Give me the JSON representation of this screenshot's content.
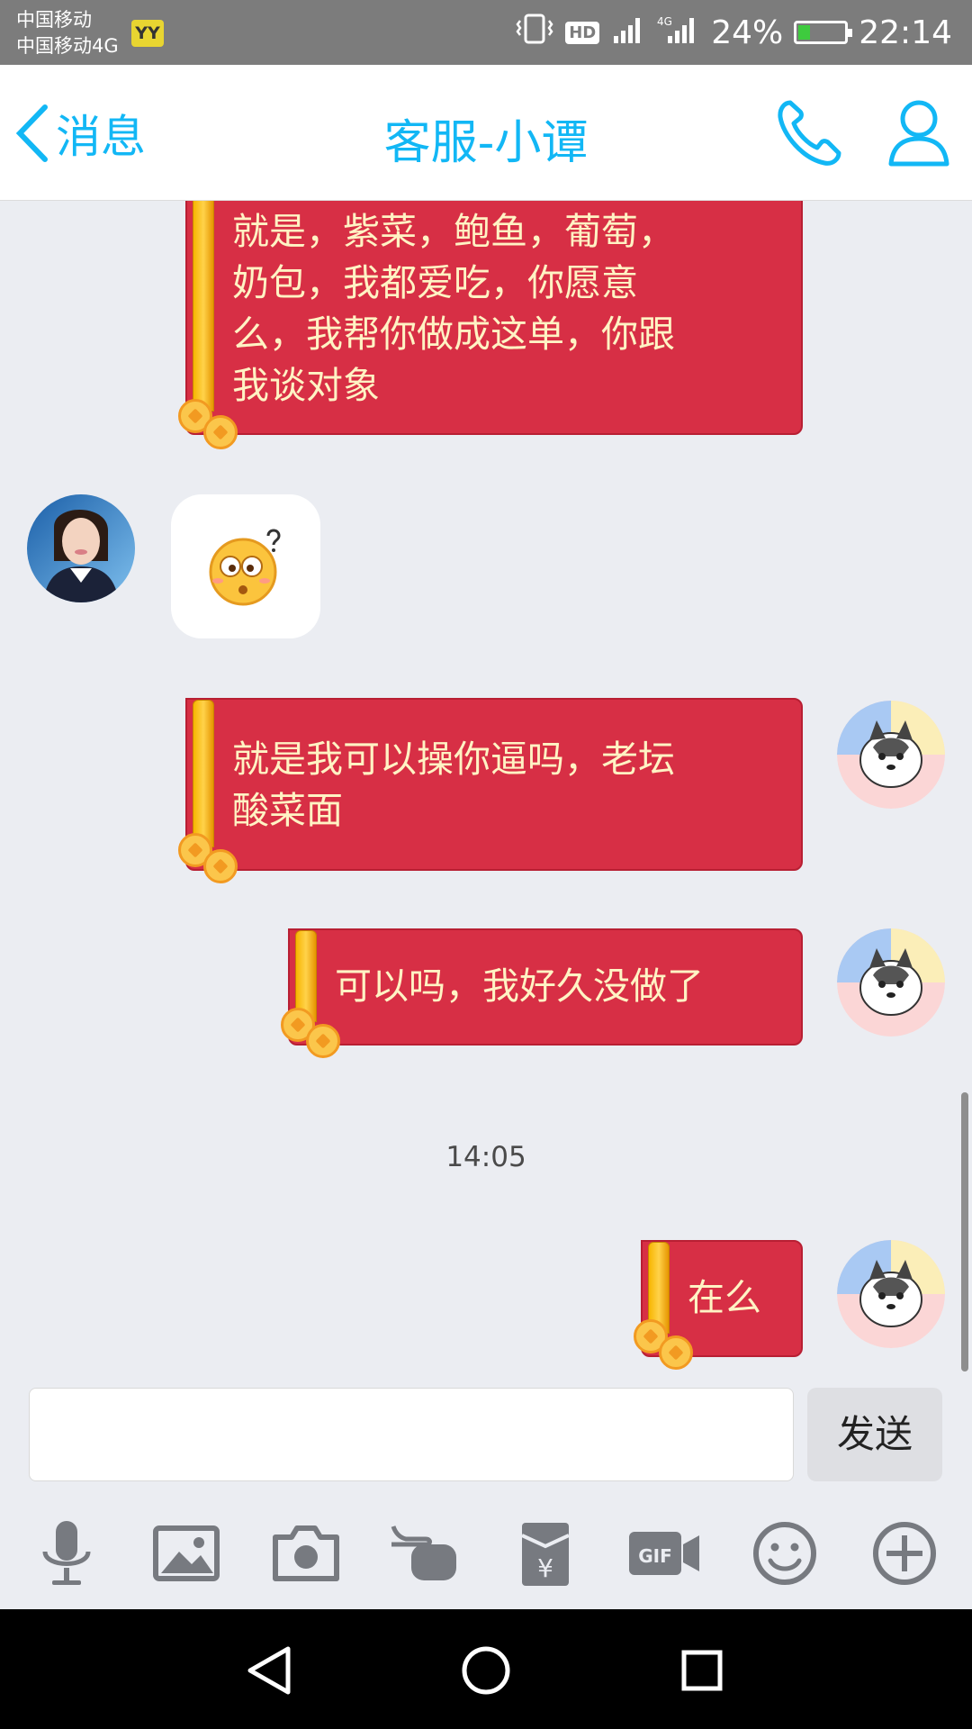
{
  "status_bar": {
    "carrier_1": "中国移动",
    "carrier_2": "中国移动4G",
    "yy_badge": "YY",
    "hd": "HD",
    "network": "4G",
    "battery": "24%",
    "time": "22:14"
  },
  "header": {
    "back_label": "消息",
    "title": "客服-小谭",
    "icons": [
      "phone-icon",
      "profile-icon"
    ]
  },
  "messages": [
    {
      "side": "right",
      "text_lines": [
        "就是，紫菜，鲍鱼，葡萄，",
        "奶包，我都爱吃，你愿意",
        "么，我帮你做成这单，你跟",
        "我谈对象"
      ]
    },
    {
      "side": "left",
      "content": "confused-emoji-sticker"
    },
    {
      "side": "right",
      "text_lines": [
        "就是我可以操你逼吗，老坛",
        "酸菜面"
      ]
    },
    {
      "side": "right",
      "text_lines": [
        "可以吗，我好久没做了"
      ]
    },
    {
      "timestamp": "14:05"
    },
    {
      "side": "right",
      "text_lines": [
        "在么"
      ]
    }
  ],
  "input": {
    "value": "",
    "send_label": "发送"
  },
  "toolbar": [
    "microphone-icon",
    "image-icon",
    "camera-icon",
    "poke-hand-icon",
    "red-packet-icon",
    "gif-icon",
    "emoji-icon",
    "plus-icon"
  ],
  "navbar": [
    "back-triangle-icon",
    "home-circle-icon",
    "recents-square-icon"
  ],
  "colors": {
    "accent": "#12b7f5",
    "bubble_red": "#d72f45",
    "bubble_text": "#fff3c4",
    "chat_bg": "#ebedf2"
  }
}
